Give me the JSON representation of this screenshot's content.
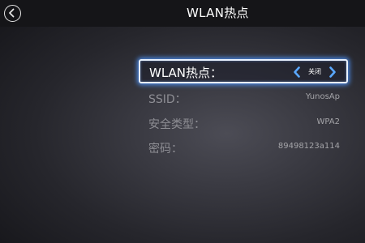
{
  "header": {
    "title": "WLAN热点",
    "back_icon": "back-arrow-icon"
  },
  "settings": {
    "hotspot": {
      "label": "WLAN热点：",
      "value": "关闭",
      "prev_icon": "chevron-left-icon",
      "next_icon": "chevron-right-icon"
    },
    "ssid": {
      "label": "SSID：",
      "value": "YunosAp"
    },
    "security": {
      "label": "安全类型：",
      "value": "WPA2"
    },
    "password": {
      "label": "密码：",
      "value": "89498123a114"
    }
  },
  "colors": {
    "focus_border": "#e9f2ff",
    "focus_glow": "#5096ff",
    "arrow_blue": "#5aa8ff",
    "header_bg": "#151518"
  }
}
